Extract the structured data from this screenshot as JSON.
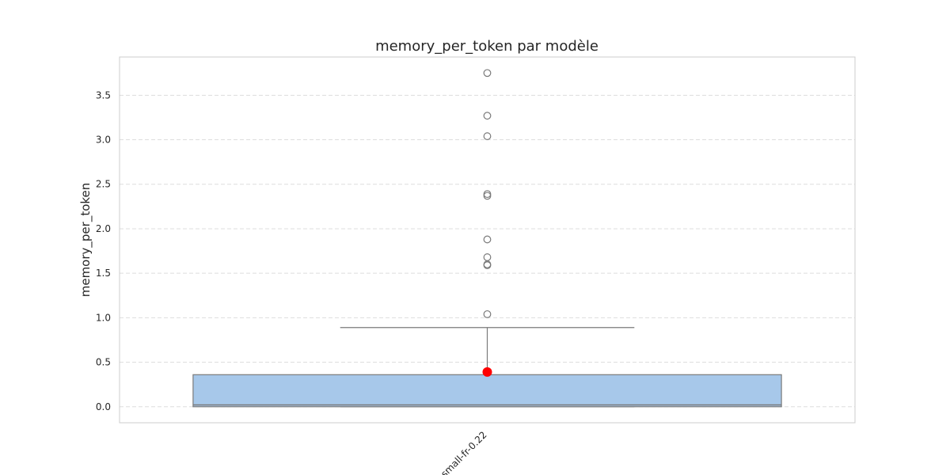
{
  "chart_data": {
    "type": "box",
    "title": "memory_per_token par modèle",
    "xlabel": "",
    "ylabel": "memory_per_token",
    "ylim": [
      -0.18,
      3.93
    ],
    "yticks": [
      0.0,
      0.5,
      1.0,
      1.5,
      2.0,
      2.5,
      3.0,
      3.5
    ],
    "ytick_labels": [
      "0.0",
      "0.5",
      "1.0",
      "1.5",
      "2.0",
      "2.5",
      "3.0",
      "3.5"
    ],
    "grid": true,
    "categories": [
      "small-fr-0.22"
    ],
    "boxes": [
      {
        "category": "small-fr-0.22",
        "q1": 0.0,
        "median": 0.02,
        "q3": 0.36,
        "whisker_low": 0.0,
        "whisker_high": 0.89,
        "outliers": [
          1.04,
          1.59,
          1.6,
          1.68,
          1.88,
          2.37,
          2.39,
          3.04,
          3.27,
          3.75
        ],
        "mean": 0.39
      }
    ],
    "colors": {
      "box_fill": "#a7c8ea",
      "box_edge": "#7a7a7a",
      "mean_marker": "#ff0000",
      "grid": "#dddddd",
      "frame": "#cccccc"
    }
  }
}
